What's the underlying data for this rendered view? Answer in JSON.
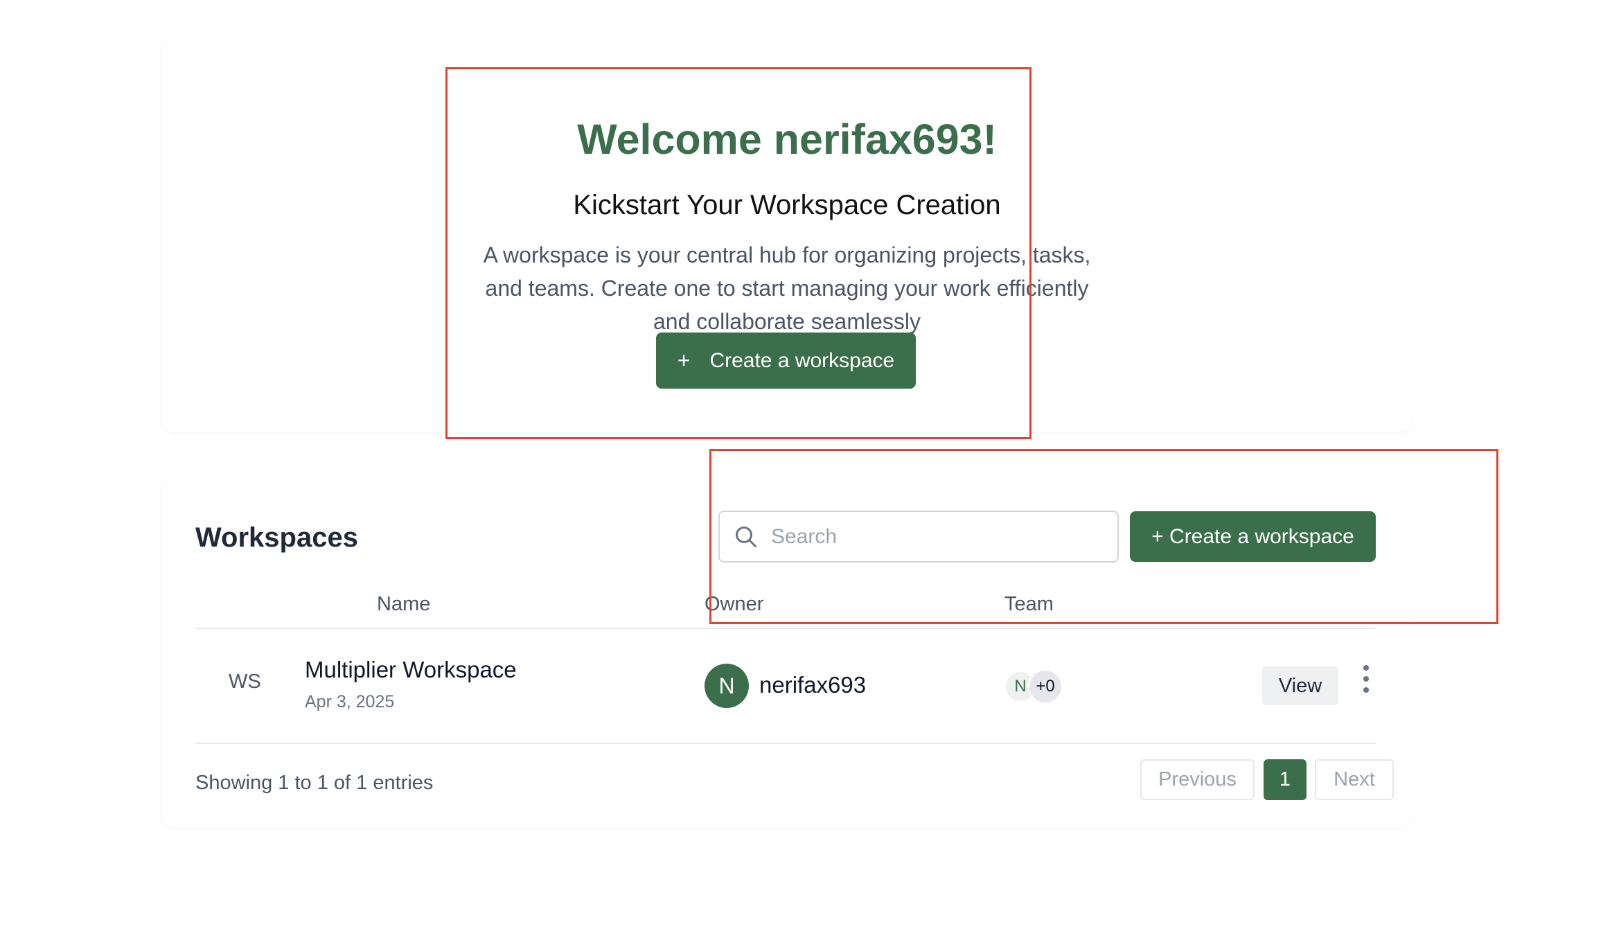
{
  "hero": {
    "title": "Welcome nerifax693!",
    "subtitle": "Kickstart Your Workspace Creation",
    "description": "A workspace is your central hub for organizing projects, tasks, and teams. Create one to start managing your work efficiently and collaborate seamlessly",
    "create_button_icon": "+",
    "create_button_label": "Create a workspace"
  },
  "workspaces": {
    "title": "Workspaces",
    "search_placeholder": "Search",
    "create_button_label": "+ Create a workspace",
    "columns": {
      "name": "Name",
      "owner": "Owner",
      "team": "Team"
    },
    "rows": [
      {
        "abbr": "WS",
        "name": "Multiplier Workspace",
        "date": "Apr 3, 2025",
        "owner_initial": "N",
        "owner_name": "nerifax693",
        "team_initial": "N",
        "team_more": "+0",
        "action_label": "View"
      }
    ],
    "footer": {
      "entries_text": "Showing 1 to 1 of 1 entries",
      "prev_label": "Previous",
      "page": "1",
      "next_label": "Next"
    }
  },
  "colors": {
    "brand_green": "#3b6e4b",
    "annotation_red": "#e2452f"
  }
}
